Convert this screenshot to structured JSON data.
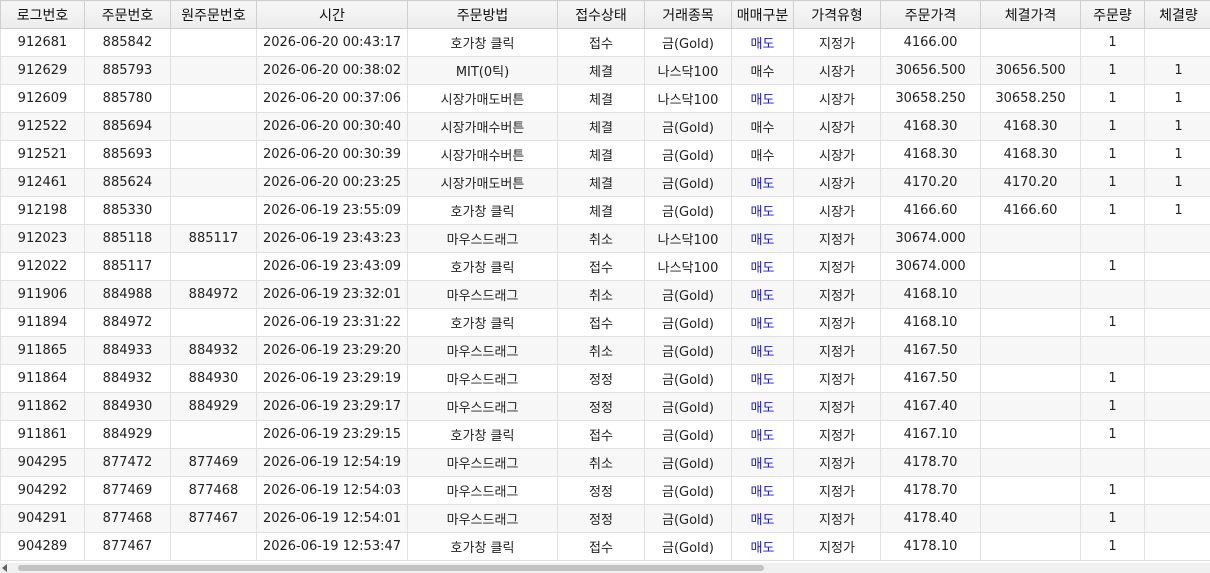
{
  "columns": [
    "로그번호",
    "주문번호",
    "원주문번호",
    "시간",
    "주문방법",
    "접수상태",
    "거래종목",
    "매매구분",
    "가격유형",
    "주문가격",
    "체결가격",
    "주문량",
    "체결량"
  ],
  "colors": {
    "sell": "#1a1acc",
    "header_bg": "#eeeeee",
    "row_alt": "#f7f7f7"
  },
  "rows": [
    {
      "log": "912681",
      "order": "885842",
      "orig": "",
      "time": "2026-06-20 00:43:17",
      "method": "호가창 클릭",
      "status": "접수",
      "item": "금(Gold)",
      "side": "매도",
      "ptype": "지정가",
      "oprice": "4166.00",
      "fprice": "",
      "oqty": "1",
      "fqty": ""
    },
    {
      "log": "912629",
      "order": "885793",
      "orig": "",
      "time": "2026-06-20 00:38:02",
      "method": "MIT(0틱)",
      "status": "체결",
      "item": "나스닥100",
      "side": "매수",
      "ptype": "시장가",
      "oprice": "30656.500",
      "fprice": "30656.500",
      "oqty": "1",
      "fqty": "1"
    },
    {
      "log": "912609",
      "order": "885780",
      "orig": "",
      "time": "2026-06-20 00:37:06",
      "method": "시장가매도버튼",
      "status": "체결",
      "item": "나스닥100",
      "side": "매도",
      "ptype": "시장가",
      "oprice": "30658.250",
      "fprice": "30658.250",
      "oqty": "1",
      "fqty": "1"
    },
    {
      "log": "912522",
      "order": "885694",
      "orig": "",
      "time": "2026-06-20 00:30:40",
      "method": "시장가매수버튼",
      "status": "체결",
      "item": "금(Gold)",
      "side": "매수",
      "ptype": "시장가",
      "oprice": "4168.30",
      "fprice": "4168.30",
      "oqty": "1",
      "fqty": "1"
    },
    {
      "log": "912521",
      "order": "885693",
      "orig": "",
      "time": "2026-06-20 00:30:39",
      "method": "시장가매수버튼",
      "status": "체결",
      "item": "금(Gold)",
      "side": "매수",
      "ptype": "시장가",
      "oprice": "4168.30",
      "fprice": "4168.30",
      "oqty": "1",
      "fqty": "1"
    },
    {
      "log": "912461",
      "order": "885624",
      "orig": "",
      "time": "2026-06-20 00:23:25",
      "method": "시장가매도버튼",
      "status": "체결",
      "item": "금(Gold)",
      "side": "매도",
      "ptype": "시장가",
      "oprice": "4170.20",
      "fprice": "4170.20",
      "oqty": "1",
      "fqty": "1"
    },
    {
      "log": "912198",
      "order": "885330",
      "orig": "",
      "time": "2026-06-19 23:55:09",
      "method": "호가창 클릭",
      "status": "체결",
      "item": "금(Gold)",
      "side": "매도",
      "ptype": "시장가",
      "oprice": "4166.60",
      "fprice": "4166.60",
      "oqty": "1",
      "fqty": "1"
    },
    {
      "log": "912023",
      "order": "885118",
      "orig": "885117",
      "time": "2026-06-19 23:43:23",
      "method": "마우스드래그",
      "status": "취소",
      "item": "나스닥100",
      "side": "매도",
      "ptype": "지정가",
      "oprice": "30674.000",
      "fprice": "",
      "oqty": "",
      "fqty": ""
    },
    {
      "log": "912022",
      "order": "885117",
      "orig": "",
      "time": "2026-06-19 23:43:09",
      "method": "호가창 클릭",
      "status": "접수",
      "item": "나스닥100",
      "side": "매도",
      "ptype": "지정가",
      "oprice": "30674.000",
      "fprice": "",
      "oqty": "1",
      "fqty": ""
    },
    {
      "log": "911906",
      "order": "884988",
      "orig": "884972",
      "time": "2026-06-19 23:32:01",
      "method": "마우스드래그",
      "status": "취소",
      "item": "금(Gold)",
      "side": "매도",
      "ptype": "지정가",
      "oprice": "4168.10",
      "fprice": "",
      "oqty": "",
      "fqty": ""
    },
    {
      "log": "911894",
      "order": "884972",
      "orig": "",
      "time": "2026-06-19 23:31:22",
      "method": "호가창 클릭",
      "status": "접수",
      "item": "금(Gold)",
      "side": "매도",
      "ptype": "지정가",
      "oprice": "4168.10",
      "fprice": "",
      "oqty": "1",
      "fqty": ""
    },
    {
      "log": "911865",
      "order": "884933",
      "orig": "884932",
      "time": "2026-06-19 23:29:20",
      "method": "마우스드래그",
      "status": "취소",
      "item": "금(Gold)",
      "side": "매도",
      "ptype": "지정가",
      "oprice": "4167.50",
      "fprice": "",
      "oqty": "",
      "fqty": ""
    },
    {
      "log": "911864",
      "order": "884932",
      "orig": "884930",
      "time": "2026-06-19 23:29:19",
      "method": "마우스드래그",
      "status": "정정",
      "item": "금(Gold)",
      "side": "매도",
      "ptype": "지정가",
      "oprice": "4167.50",
      "fprice": "",
      "oqty": "1",
      "fqty": ""
    },
    {
      "log": "911862",
      "order": "884930",
      "orig": "884929",
      "time": "2026-06-19 23:29:17",
      "method": "마우스드래그",
      "status": "정정",
      "item": "금(Gold)",
      "side": "매도",
      "ptype": "지정가",
      "oprice": "4167.40",
      "fprice": "",
      "oqty": "1",
      "fqty": ""
    },
    {
      "log": "911861",
      "order": "884929",
      "orig": "",
      "time": "2026-06-19 23:29:15",
      "method": "호가창 클릭",
      "status": "접수",
      "item": "금(Gold)",
      "side": "매도",
      "ptype": "지정가",
      "oprice": "4167.10",
      "fprice": "",
      "oqty": "1",
      "fqty": ""
    },
    {
      "log": "904295",
      "order": "877472",
      "orig": "877469",
      "time": "2026-06-19 12:54:19",
      "method": "마우스드래그",
      "status": "취소",
      "item": "금(Gold)",
      "side": "매도",
      "ptype": "지정가",
      "oprice": "4178.70",
      "fprice": "",
      "oqty": "",
      "fqty": ""
    },
    {
      "log": "904292",
      "order": "877469",
      "orig": "877468",
      "time": "2026-06-19 12:54:03",
      "method": "마우스드래그",
      "status": "정정",
      "item": "금(Gold)",
      "side": "매도",
      "ptype": "지정가",
      "oprice": "4178.70",
      "fprice": "",
      "oqty": "1",
      "fqty": ""
    },
    {
      "log": "904291",
      "order": "877468",
      "orig": "877467",
      "time": "2026-06-19 12:54:01",
      "method": "마우스드래그",
      "status": "정정",
      "item": "금(Gold)",
      "side": "매도",
      "ptype": "지정가",
      "oprice": "4178.40",
      "fprice": "",
      "oqty": "1",
      "fqty": ""
    },
    {
      "log": "904289",
      "order": "877467",
      "orig": "",
      "time": "2026-06-19 12:53:47",
      "method": "호가창 클릭",
      "status": "접수",
      "item": "금(Gold)",
      "side": "매도",
      "ptype": "지정가",
      "oprice": "4178.10",
      "fprice": "",
      "oqty": "1",
      "fqty": ""
    }
  ]
}
